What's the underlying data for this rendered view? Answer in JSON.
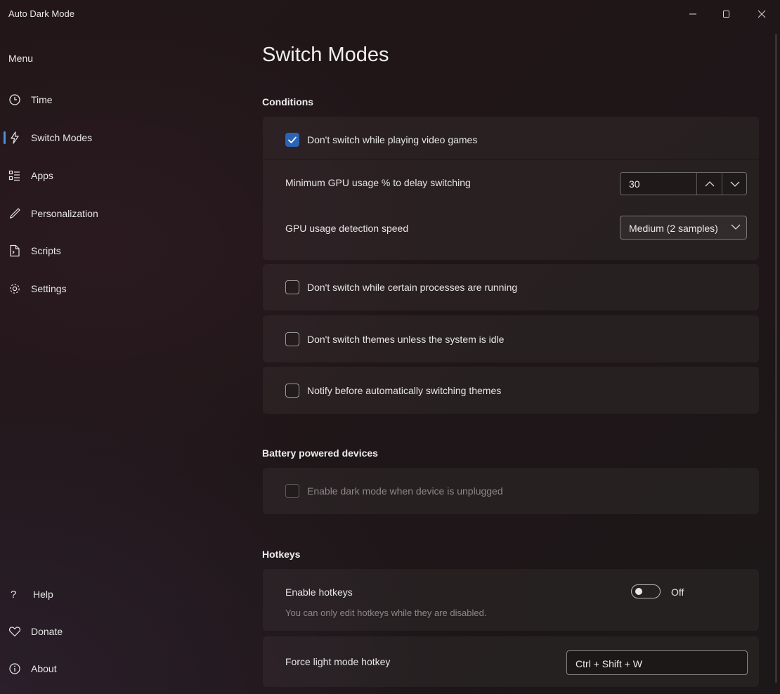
{
  "window": {
    "title": "Auto Dark Mode",
    "controls": [
      "minimize",
      "maximize",
      "close"
    ]
  },
  "sidebar": {
    "menu_label": "Menu",
    "items": [
      {
        "label": "Time",
        "icon": "clock-icon"
      },
      {
        "label": "Switch Modes",
        "icon": "bolt-icon",
        "active": true
      },
      {
        "label": "Apps",
        "icon": "apps-list-icon"
      },
      {
        "label": "Personalization",
        "icon": "pen-icon"
      },
      {
        "label": "Scripts",
        "icon": "script-file-icon"
      },
      {
        "label": "Settings",
        "icon": "gear-icon"
      }
    ],
    "footer_items": [
      {
        "label": "Help",
        "icon": "question-icon"
      },
      {
        "label": "Donate",
        "icon": "heart-icon"
      },
      {
        "label": "About",
        "icon": "info-icon"
      }
    ]
  },
  "main": {
    "page_title": "Switch Modes",
    "conditions": {
      "section_title": "Conditions",
      "games_checkbox": {
        "label": "Don't switch while playing video games",
        "checked": true
      },
      "gpu_threshold": {
        "label": "Minimum GPU usage % to delay switching",
        "value": "30"
      },
      "gpu_speed": {
        "label": "GPU usage detection speed",
        "value": "Medium (2 samples)"
      },
      "processes_checkbox": {
        "label": "Don't switch while certain processes are running",
        "checked": false
      },
      "idle_checkbox": {
        "label": "Don't switch themes unless the system is idle",
        "checked": false
      },
      "notify_checkbox": {
        "label": "Notify before automatically switching themes",
        "checked": false
      }
    },
    "battery": {
      "section_title": "Battery powered devices",
      "unplugged_checkbox": {
        "label": "Enable dark mode when device is unplugged",
        "checked": false,
        "disabled": true
      }
    },
    "hotkeys": {
      "section_title": "Hotkeys",
      "enable": {
        "label": "Enable hotkeys",
        "description": "You can only edit hotkeys while they are disabled.",
        "state_label": "Off",
        "on": false
      },
      "force_light": {
        "label": "Force light mode hotkey",
        "value": "Ctrl + Shift + W"
      }
    }
  },
  "colors": {
    "accent": "#2b63b5",
    "nav_indicator": "#4c8fe0"
  }
}
